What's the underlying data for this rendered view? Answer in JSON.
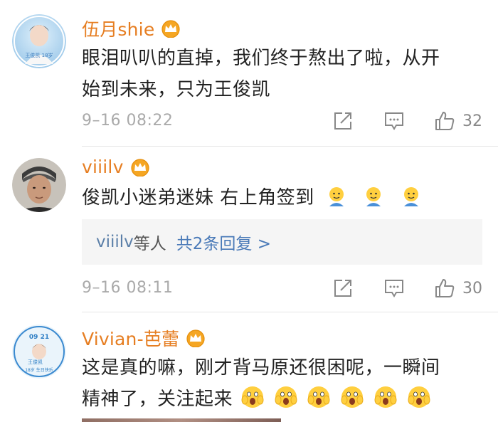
{
  "comments": [
    {
      "username": "伍月shie",
      "text_line1": "眼泪叭叭的直掉，我们终于熬出了啦，从开",
      "text_line2": "始到未来，只为王俊凯",
      "time": "9–16 08:22",
      "likes": "32",
      "avatar_text": "王俊凯 18岁"
    },
    {
      "username": "viiilv",
      "text": "俊凯小迷弟迷妹 右上角签到",
      "emoji_count": 3,
      "reply_box": {
        "names": "viiilv",
        "suffix": "等人",
        "link": "共2条回复 >"
      },
      "time": "9–16 08:11",
      "likes": "30"
    },
    {
      "username": "Vivian-芭蕾",
      "text_line1": "这是真的嘛，刚才背马原还很困呢，一瞬间",
      "text_line2": "精神了，关注起来",
      "emoji_count": 6,
      "avatar_text_top": "09 21",
      "avatar_text_mid": "王俊凯",
      "avatar_text_bottom": "18岁 生日快乐"
    }
  ],
  "colors": {
    "username": "#e67e22",
    "crown": "#f5a623",
    "link": "#4a7ab8",
    "meta": "#aaaaaa"
  },
  "icons": [
    "crown-badge-icon",
    "share-icon",
    "comment-icon",
    "like-icon",
    "emoji-icon",
    "scared-emoji-icon"
  ]
}
